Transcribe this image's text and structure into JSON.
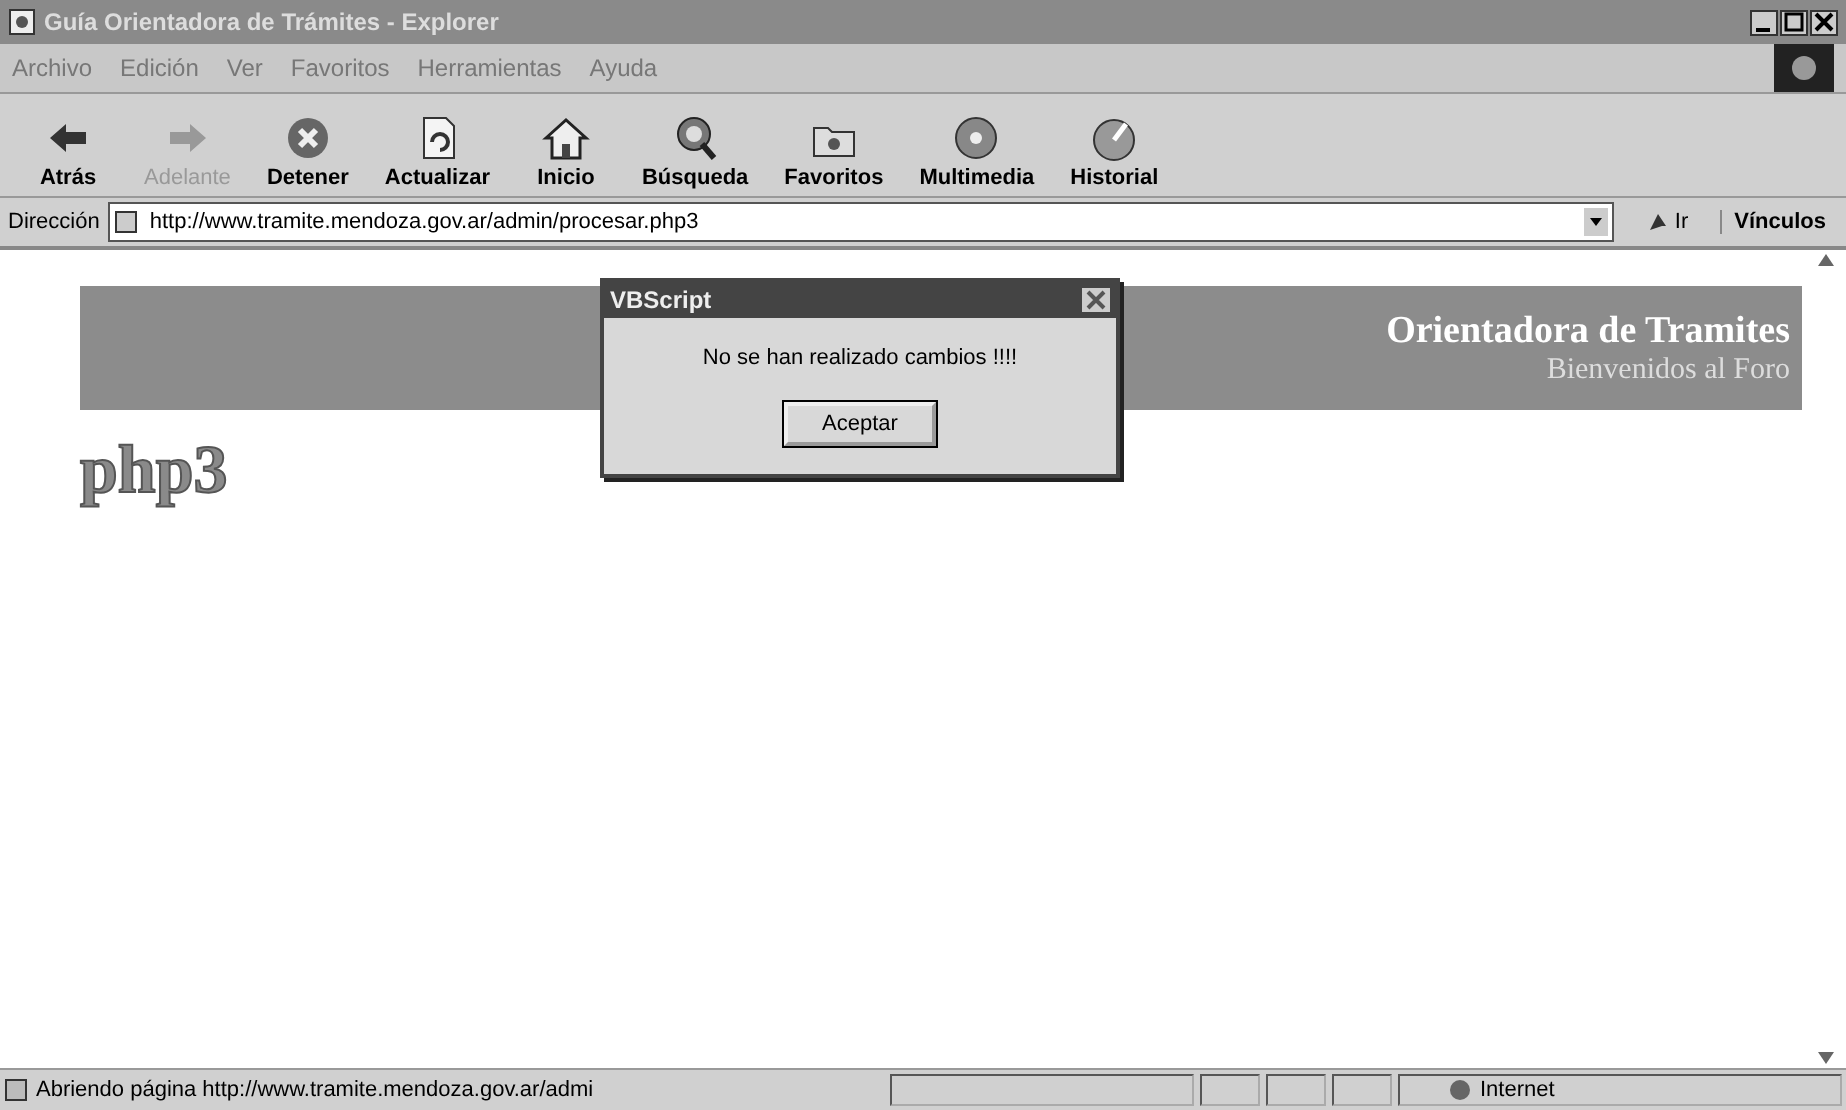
{
  "window": {
    "title": "Guía Orientadora de Trámites - Explorer"
  },
  "menu": [
    "Archivo",
    "Edición",
    "Ver",
    "Favoritos",
    "Herramientas",
    "Ayuda"
  ],
  "toolbar": [
    {
      "label": "Atrás",
      "kind": "back",
      "disabled": false
    },
    {
      "label": "Adelante",
      "kind": "forward",
      "disabled": true
    },
    {
      "label": "Detener",
      "kind": "stop",
      "disabled": false
    },
    {
      "label": "Actualizar",
      "kind": "refresh",
      "disabled": false
    },
    {
      "label": "Inicio",
      "kind": "home",
      "disabled": false
    },
    {
      "label": "Búsqueda",
      "kind": "search",
      "disabled": false
    },
    {
      "label": "Favoritos",
      "kind": "favorites",
      "disabled": false
    },
    {
      "label": "Multimedia",
      "kind": "media",
      "disabled": false
    },
    {
      "label": "Historial",
      "kind": "history",
      "disabled": false
    }
  ],
  "address": {
    "label": "Dirección",
    "value": "http://www.tramite.mendoza.gov.ar/admin/procesar.php3",
    "go": "Ir",
    "links": "Vínculos"
  },
  "page": {
    "banner_title": "Orientadora de Tramites",
    "banner_subtitle": "Bienvenidos al Foro",
    "logo": "php3"
  },
  "dialog": {
    "title": "VBScript",
    "message": "No se han realizado cambios !!!!",
    "button": "Aceptar"
  },
  "status_bar": {
    "text": "Abriendo página http://www.tramite.mendoza.gov.ar/admi",
    "zone": "Internet"
  }
}
